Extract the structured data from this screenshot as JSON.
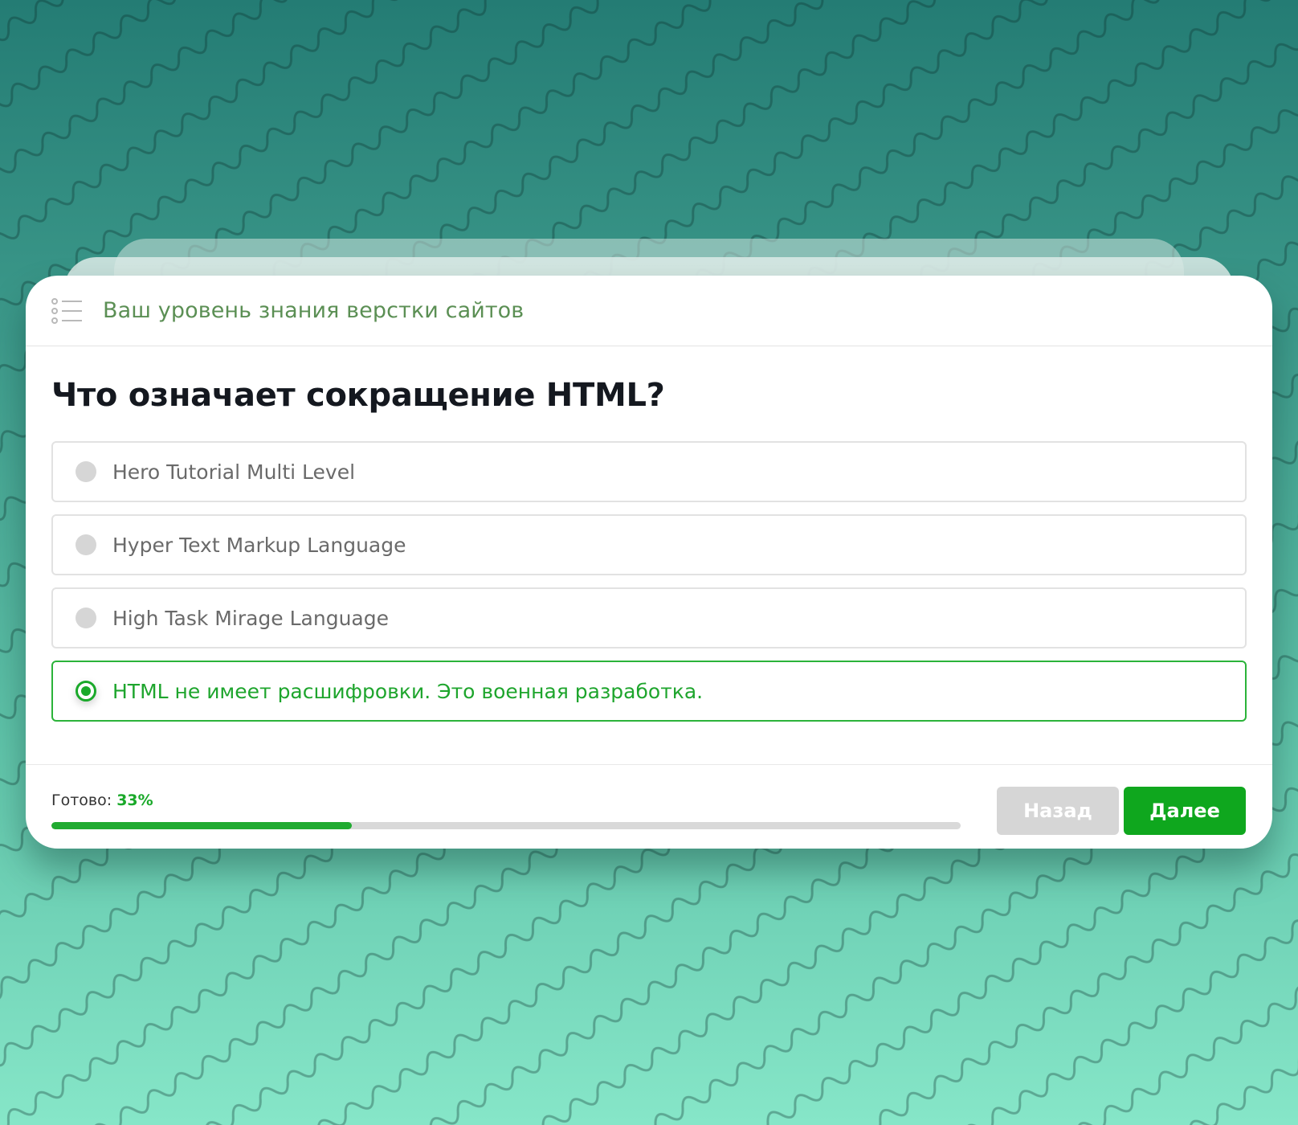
{
  "quiz": {
    "title": "Ваш уровень знания верстки сайтов",
    "question": "Что означает сокращение HTML?",
    "options": [
      {
        "label": "Hero Tutorial Multi Level",
        "selected": false
      },
      {
        "label": "Hyper Text Markup Language",
        "selected": false
      },
      {
        "label": "High Task Mirage Language",
        "selected": false
      },
      {
        "label": "HTML не имеет расшифровки. Это военная разработка.",
        "selected": true
      }
    ]
  },
  "progress": {
    "label": "Готово:",
    "value_text": "33%",
    "fraction": 0.33
  },
  "buttons": {
    "back": "Назад",
    "next": "Далее"
  },
  "colors": {
    "accent": "#1aa92a",
    "title": "#5b8f54",
    "disabled": "#d6d6d6"
  },
  "icons": {
    "header": "list-icon"
  }
}
